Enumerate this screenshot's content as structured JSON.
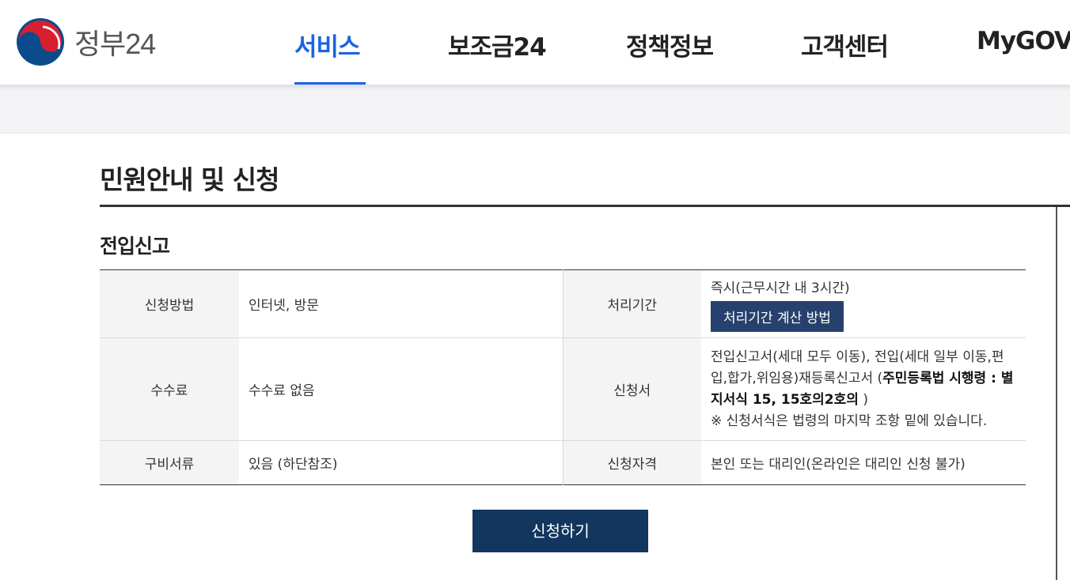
{
  "header": {
    "logo_text": "정부24",
    "nav": [
      "서비스",
      "보조금24",
      "정책정보",
      "고객센터",
      "MyGOV"
    ]
  },
  "page": {
    "title": "민원안내 및 신청",
    "section_title": "전입신고"
  },
  "info_table": {
    "method_label": "신청방법",
    "method_value": "인터넷, 방문",
    "period_label": "처리기간",
    "period_value": "즉시(근무시간 내 3시간)",
    "period_calc_button": "처리기간 계산 방법",
    "fee_label": "수수료",
    "fee_value": "수수료 없음",
    "form_label": "신청서",
    "form_text_1": "전입신고서(세대 모두 이동), 전입(세대 일부 이동,편입,합가,위임용)재등록신고서 (",
    "form_text_bold": "주민등록법 시행령 : 별지서식 15, 15호의2호의",
    "form_text_2": " )",
    "form_note": "※ 신청서식은 법령의 마지막 조항 밑에 있습니다.",
    "docs_label": "구비서류",
    "docs_value": "있음 (하단참조)",
    "eligibility_label": "신청자격",
    "eligibility_value": "본인 또는 대리인(온라인은 대리인 신청 불가)"
  },
  "apply_button": "신청하기",
  "colors": {
    "accent": "#1a64e6",
    "navy_button": "#13365f",
    "calc_button": "#26416e"
  }
}
